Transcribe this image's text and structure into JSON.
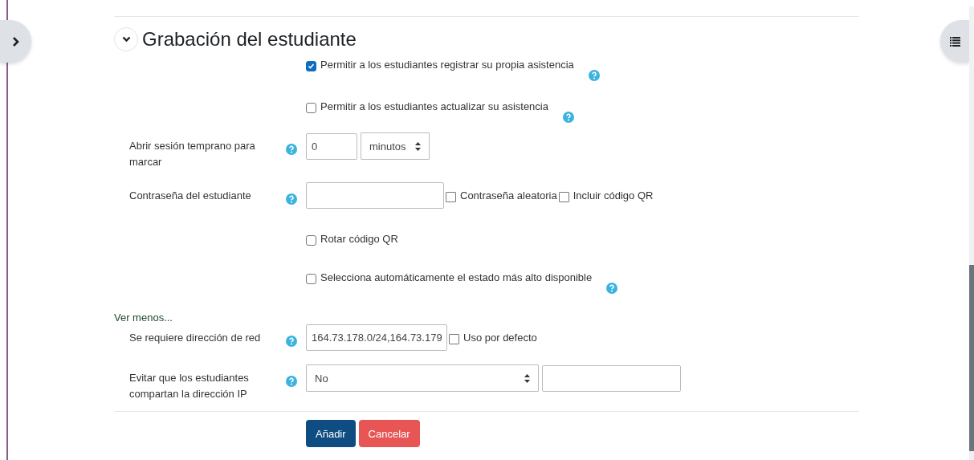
{
  "section": {
    "title": "Grabación del estudiante",
    "expanded": true
  },
  "rows": [
    {
      "kind": "checkbox",
      "label": "Permitir a los estudiantes registrar su propia asistencia",
      "checked": true,
      "help": true
    },
    {
      "kind": "checkbox",
      "label": "Permitir a los estudiantes actualizar su asistencia",
      "checked": false,
      "help": true
    },
    {
      "kind": "field",
      "label": "Abrir sesión temprano para marcar",
      "controls": [
        {
          "kind": "input",
          "value": "0"
        },
        {
          "kind": "select",
          "value": "minutos"
        }
      ]
    },
    {
      "kind": "field",
      "label": "Contraseña del estudiante",
      "controls": [
        {
          "kind": "input"
        },
        {
          "kind": "checkbox",
          "label": "Contraseña aleatoria",
          "checked": false
        },
        {
          "kind": "checkbox",
          "label": "Incluir código QR",
          "checked": false
        }
      ]
    },
    {
      "kind": "checkbox",
      "label": "Rotar código QR",
      "checked": false,
      "help": false
    },
    {
      "kind": "checkbox",
      "label": "Selecciona automáticamente el estado más alto disponible",
      "checked": false,
      "help": true
    },
    {
      "kind": "link",
      "label": "Ver menos..."
    },
    {
      "kind": "field",
      "label": "Se requiere dirección de red",
      "controls": [
        {
          "kind": "input",
          "value": "164.73.178.0/24,164.73.179"
        },
        {
          "kind": "checkbox",
          "label": "Uso por defecto",
          "checked": false
        }
      ]
    },
    {
      "kind": "field",
      "label": "Evitar que los estudiantes compartan la dirección IP",
      "controls": [
        {
          "kind": "select",
          "value": "No"
        },
        {
          "kind": "input"
        }
      ]
    }
  ],
  "buttons": [
    {
      "label": "Añadir",
      "kind": "primary"
    },
    {
      "label": "Cancelar",
      "kind": "danger"
    }
  ]
}
